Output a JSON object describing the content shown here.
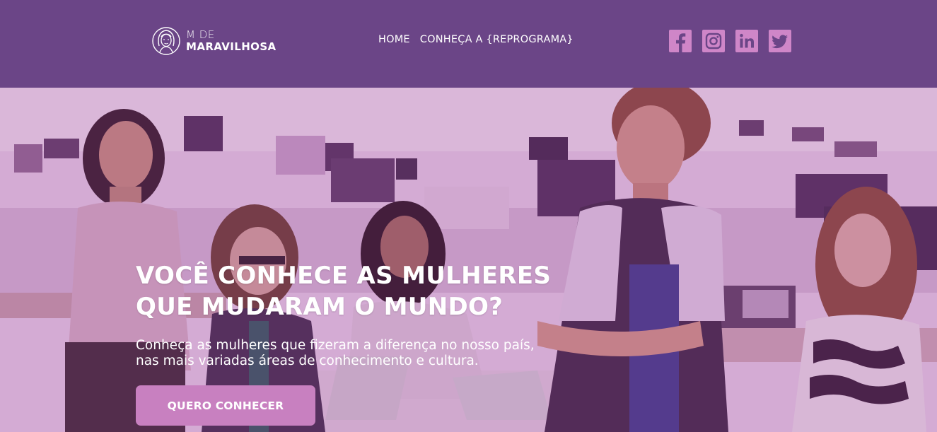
{
  "brand": {
    "small": "M DE",
    "big": "MARAVILHOSA",
    "icon": "woman-face-logo"
  },
  "nav": {
    "items": [
      {
        "label": "HOME"
      },
      {
        "label": "CONHEÇA A {REPROGRAMA}"
      }
    ]
  },
  "social": {
    "items": [
      {
        "name": "facebook-icon"
      },
      {
        "name": "instagram-icon"
      },
      {
        "name": "linkedin-icon"
      },
      {
        "name": "twitter-icon"
      }
    ],
    "color": "#cf86c8"
  },
  "hero": {
    "title_line1": "VOCÊ CONHECE AS MULHERES",
    "title_line2": "QUE MUDARAM O MUNDO?",
    "subtitle_line1": "Conheça as mulheres que fizeram a diferença no nosso país,",
    "subtitle_line2": "nas mais variadas áreas de conhecimento e cultura.",
    "cta_label": "QUERO CONHECER"
  },
  "colors": {
    "header_bg": "#6b4587",
    "accent": "#c880c0",
    "text": "#ffffff"
  }
}
